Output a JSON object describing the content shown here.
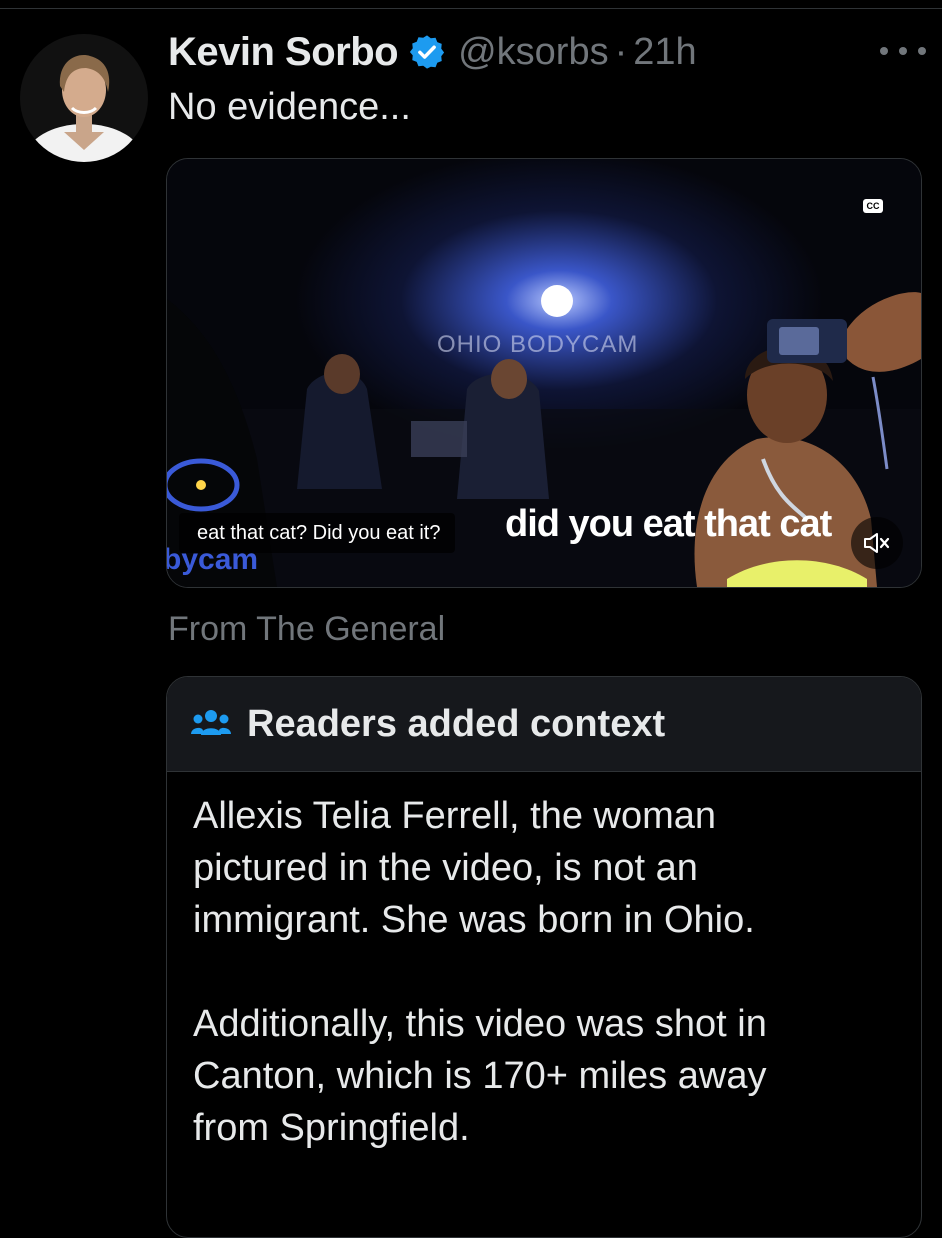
{
  "tweet": {
    "author": {
      "name": "Kevin Sorbo",
      "handle": "@ksorbs",
      "verified": true
    },
    "separator": "·",
    "time": "21h",
    "text": "No evidence...",
    "media": {
      "type": "video",
      "watermark": "OHIO BODYCAM",
      "caption": "eat that cat? Did you eat it?",
      "burned_in_text": "did you eat that cat",
      "logo_text": "bycam",
      "cc_label": "CC",
      "muted": true
    },
    "attribution": "From The General"
  },
  "community_note": {
    "title": "Readers added context",
    "paragraphs": [
      [
        "Allexis Telia Ferrell, the woman",
        "pictured in the video, is not an",
        "immigrant. She was born in Ohio."
      ],
      [
        "Additionally, this video was shot in",
        "Canton, which is 170+ miles away",
        "from Springfield."
      ]
    ]
  },
  "colors": {
    "background": "#000000",
    "text_primary": "#e7e9ea",
    "text_secondary": "#71767b",
    "verified_badge": "#1d9bf0",
    "note_icon": "#1d9bf0",
    "border": "#2f3336"
  }
}
